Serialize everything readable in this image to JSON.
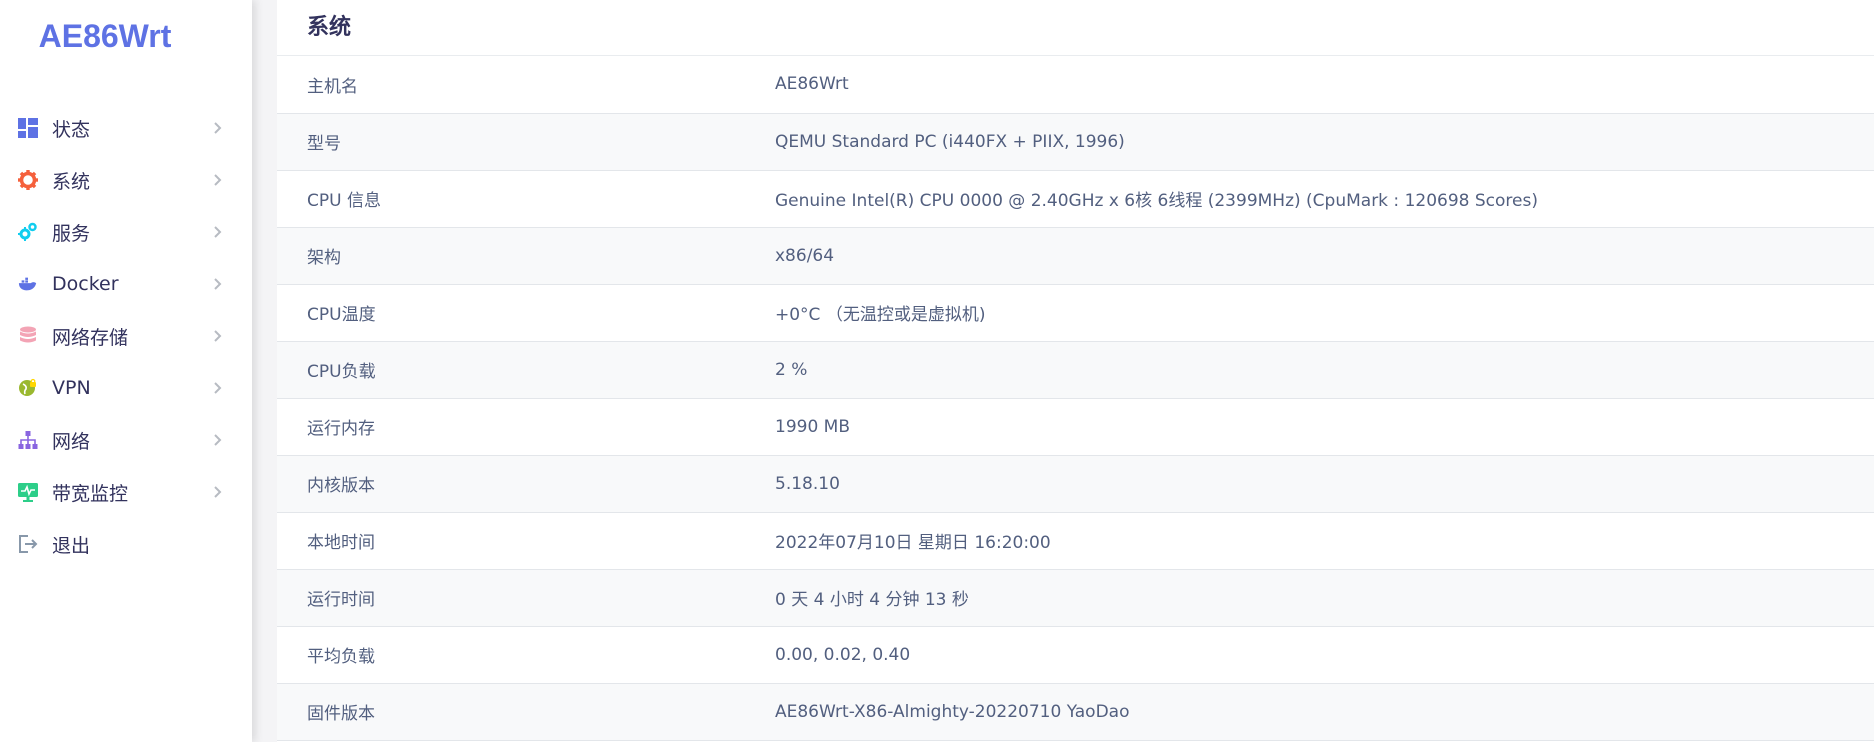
{
  "brand": "AE86Wrt",
  "colors": {
    "brand": "#5e72e4",
    "text": "#32325d",
    "muted": "#525f7f"
  },
  "sidebar": {
    "items": [
      {
        "label": "状态",
        "icon": "dashboard-icon",
        "has_chevron": true
      },
      {
        "label": "系统",
        "icon": "gear-icon",
        "has_chevron": true
      },
      {
        "label": "服务",
        "icon": "gears-icon",
        "has_chevron": true
      },
      {
        "label": "Docker",
        "icon": "docker-icon",
        "has_chevron": true
      },
      {
        "label": "网络存储",
        "icon": "database-icon",
        "has_chevron": true
      },
      {
        "label": "VPN",
        "icon": "globe-lock-icon",
        "has_chevron": true
      },
      {
        "label": "网络",
        "icon": "network-icon",
        "has_chevron": true
      },
      {
        "label": "带宽监控",
        "icon": "monitor-icon",
        "has_chevron": true
      },
      {
        "label": "退出",
        "icon": "logout-icon",
        "has_chevron": false
      }
    ]
  },
  "main": {
    "title": "系统",
    "rows": [
      {
        "label": "主机名",
        "value": "AE86Wrt"
      },
      {
        "label": "型号",
        "value": "QEMU Standard PC (i440FX + PIIX, 1996)"
      },
      {
        "label": "CPU 信息",
        "value": "Genuine Intel(R) CPU 0000 @ 2.40GHz x 6核 6线程 (2399MHz) (CpuMark : 120698 Scores)"
      },
      {
        "label": "架构",
        "value": "x86/64"
      },
      {
        "label": "CPU温度",
        "value": "+0°C （无温控或是虚拟机)"
      },
      {
        "label": "CPU负载",
        "value": "2 %"
      },
      {
        "label": "运行内存",
        "value": "1990 MB"
      },
      {
        "label": "内核版本",
        "value": "5.18.10"
      },
      {
        "label": "本地时间",
        "value": "2022年07月10日 星期日 16:20:00"
      },
      {
        "label": "运行时间",
        "value": "0 天 4 小时 4 分钟 13 秒"
      },
      {
        "label": "平均负载",
        "value": "0.00, 0.02, 0.40"
      },
      {
        "label": "固件版本",
        "value": "AE86Wrt-X86-Almighty-20220710 YaoDao"
      }
    ]
  }
}
